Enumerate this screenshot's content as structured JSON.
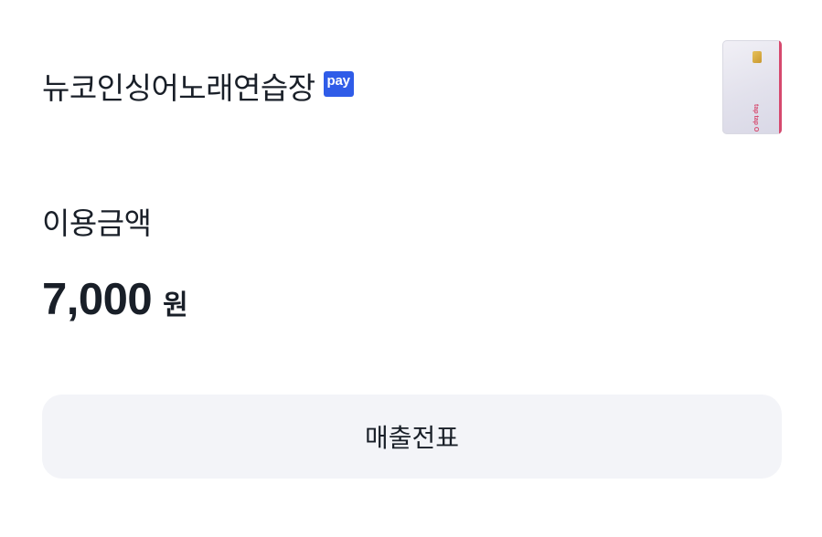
{
  "merchant": {
    "name": "뉴코인싱어노래연습장",
    "pay_badge": "pay",
    "badge_color": "#2f5ce8"
  },
  "card": {
    "icon": "card-image",
    "brand_text": "tap tap O",
    "accent_color": "#d6496e"
  },
  "amount": {
    "label": "이용금액",
    "value": "7,000",
    "unit": "원"
  },
  "actions": {
    "receipt_label": "매출전표"
  }
}
